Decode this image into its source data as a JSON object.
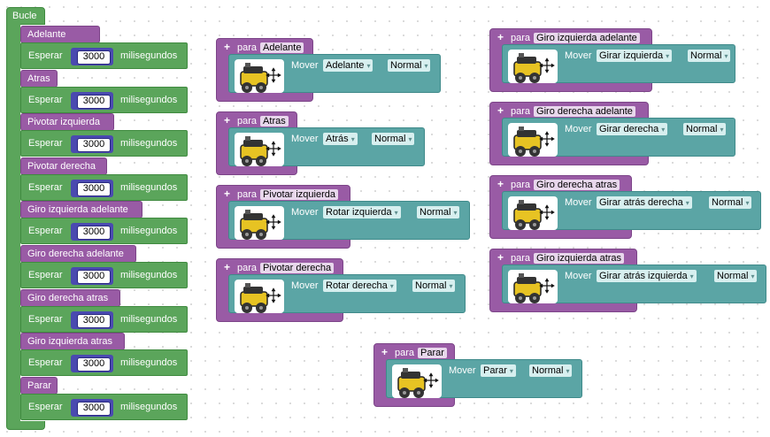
{
  "loop": {
    "label": "Bucle",
    "wait_label": "Esperar",
    "unit_label": "milisegundos",
    "steps": [
      {
        "call": "Adelante",
        "ms": "3000"
      },
      {
        "call": "Atras",
        "ms": "3000"
      },
      {
        "call": "Pivotar izquierda",
        "ms": "3000"
      },
      {
        "call": "Pivotar derecha",
        "ms": "3000"
      },
      {
        "call": "Giro izquierda adelante",
        "ms": "3000"
      },
      {
        "call": "Giro derecha adelante",
        "ms": "3000"
      },
      {
        "call": "Giro derecha atras",
        "ms": "3000"
      },
      {
        "call": "Giro izquierda atras",
        "ms": "3000"
      },
      {
        "call": "Parar",
        "ms": "3000"
      }
    ]
  },
  "labels": {
    "plus": "+",
    "para": "para",
    "mover": "Mover",
    "arrow": "▾"
  },
  "procedures": [
    {
      "name": "Adelante",
      "direction": "Adelante",
      "speed": "Normal"
    },
    {
      "name": "Atras",
      "direction": "Atrás",
      "speed": "Normal"
    },
    {
      "name": "Pivotar izquierda",
      "direction": "Rotar izquierda",
      "speed": "Normal"
    },
    {
      "name": "Pivotar derecha",
      "direction": "Rotar derecha",
      "speed": "Normal"
    },
    {
      "name": "Giro izquierda adelante",
      "direction": "Girar izquierda",
      "speed": "Normal"
    },
    {
      "name": "Giro derecha adelante",
      "direction": "Girar derecha",
      "speed": "Normal"
    },
    {
      "name": "Giro derecha atras",
      "direction": "Girar atrás derecha",
      "speed": "Normal"
    },
    {
      "name": "Giro izquierda atras",
      "direction": "Girar atrás izquierda",
      "speed": "Normal"
    },
    {
      "name": "Parar",
      "direction": "Parar",
      "speed": "Normal"
    }
  ],
  "icons": {
    "robot": "robot-icon",
    "move_arrows": "move-arrows-icon"
  },
  "colors": {
    "loop": "#5ba55b",
    "procedure": "#995ba5",
    "motion": "#5ba5a5",
    "number": "#4a4ab0"
  }
}
